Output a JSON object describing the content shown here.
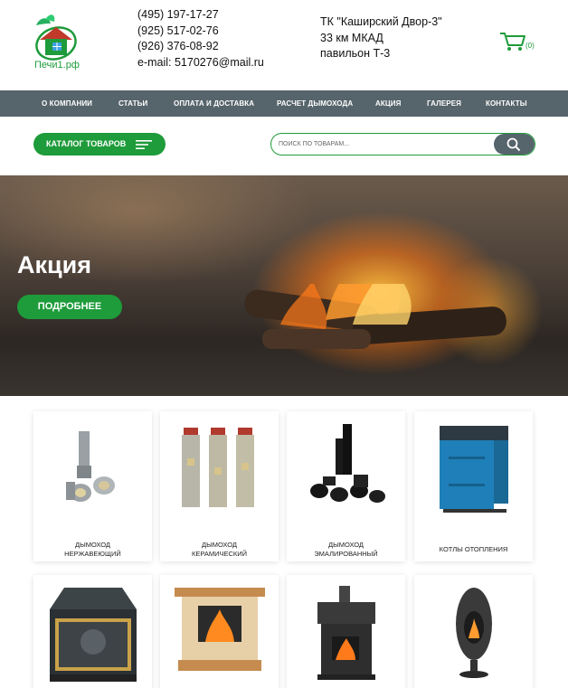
{
  "header": {
    "logo_text": "Печи1.рф",
    "phones": [
      "(495) 197-17-27",
      "(925) 517-02-76",
      "(926) 376-08-92"
    ],
    "email": "e-mail: 5170276@mail.ru",
    "address": [
      "ТК \"Каширский Двор-3\"",
      "33 км МКАД",
      "павильон Т-3"
    ],
    "cart_count": "(0)"
  },
  "nav": {
    "items": [
      "О компании",
      "Статьи",
      "Оплата и доставка",
      "Расчет дымохода",
      "Акция",
      "Галерея",
      "Контакты"
    ]
  },
  "toolbar": {
    "catalog_label": "Каталог товаров",
    "search_placeholder": "Поиск по товарам..."
  },
  "banner": {
    "title": "Акция",
    "button_label": "Подробнее"
  },
  "products": [
    {
      "line1": "Дымоход",
      "line2": "нержавеющий"
    },
    {
      "line1": "Дымоход",
      "line2": "керамический"
    },
    {
      "line1": "Дымоход",
      "line2": "эмалированный"
    },
    {
      "line1": "",
      "line2": "Котлы отопления"
    }
  ],
  "colors": {
    "brand_green": "#1e9b3a",
    "nav_gray": "#56646b"
  }
}
